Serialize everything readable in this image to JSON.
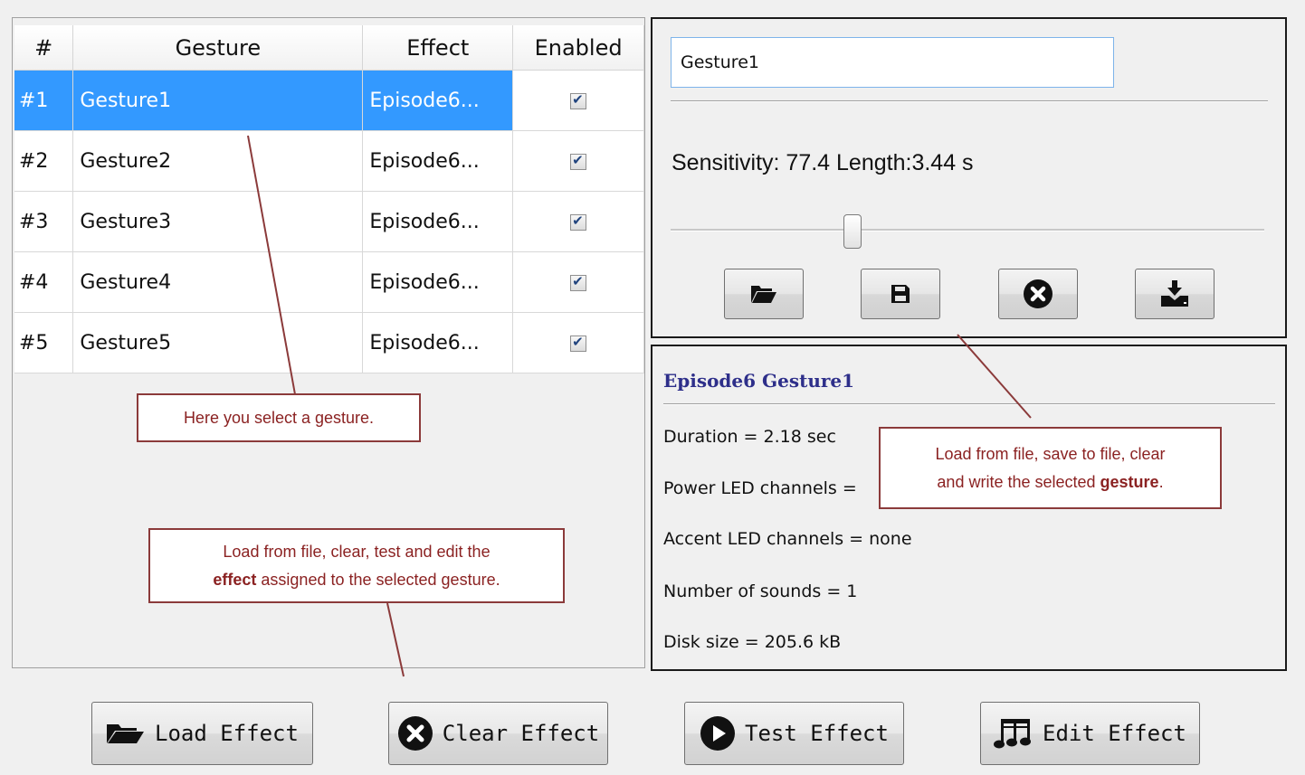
{
  "table": {
    "headers": {
      "num": "#",
      "gesture": "Gesture",
      "effect": "Effect",
      "enabled": "Enabled"
    },
    "rows": [
      {
        "num": "#1",
        "gesture": "Gesture1",
        "effect": "Episode6...",
        "enabled": true,
        "selected": true
      },
      {
        "num": "#2",
        "gesture": "Gesture2",
        "effect": "Episode6...",
        "enabled": true,
        "selected": false
      },
      {
        "num": "#3",
        "gesture": "Gesture3",
        "effect": "Episode6...",
        "enabled": true,
        "selected": false
      },
      {
        "num": "#4",
        "gesture": "Gesture4",
        "effect": "Episode6...",
        "enabled": true,
        "selected": false
      },
      {
        "num": "#5",
        "gesture": "Gesture5",
        "effect": "Episode6...",
        "enabled": true,
        "selected": false
      }
    ]
  },
  "gesture_panel": {
    "name_value": "Gesture1",
    "sensitivity_text": "Sensitivity: 77.4  Length:3.44 s",
    "slider_level": 0.3,
    "icon_buttons": [
      "open-folder-icon",
      "save-disk-icon",
      "clear-x-icon",
      "write-download-icon"
    ]
  },
  "info": {
    "title": "Episode6 Gesture1",
    "lines": {
      "duration": "Duration = 2.18 sec",
      "power": "Power LED channels =",
      "accent": "Accent LED channels =  none",
      "sounds": "Number of sounds = 1",
      "disk": "Disk size = 205.6 kB"
    }
  },
  "bottom_buttons": {
    "load": "Load Effect",
    "clear": "Clear Effect",
    "test": "Test Effect",
    "edit": "Edit Effect"
  },
  "callouts": {
    "select": "Here you select a gesture.",
    "gesture_pre": "Load from file, save to file, clear",
    "gesture_mid": "and write the selected ",
    "gesture_bold": "gesture",
    "gesture_post": ".",
    "effect_pre": "Load from file, clear, test and edit the",
    "effect_bold": "effect",
    "effect_post": " assigned to the selected gesture."
  },
  "colors": {
    "selection": "#3399ff",
    "callout_border": "#8b3a3a",
    "callout_text": "#8b2222",
    "info_title": "#2e2f8a"
  }
}
